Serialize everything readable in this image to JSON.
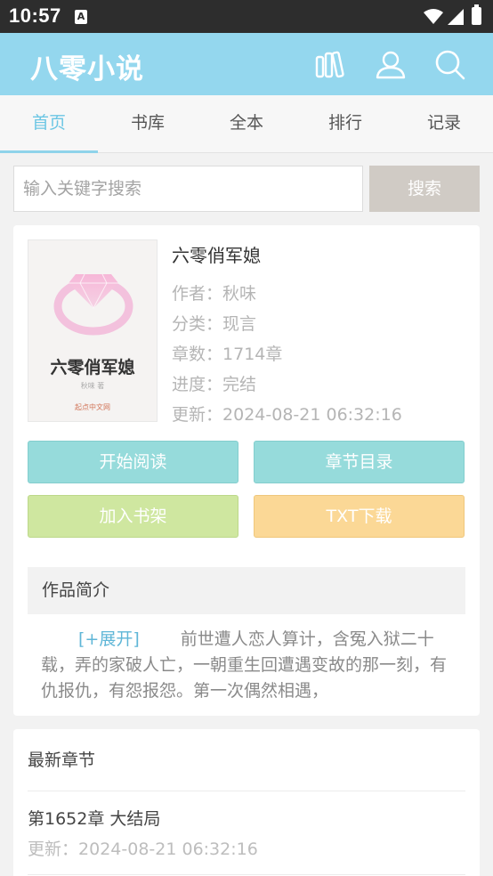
{
  "status_bar": {
    "time": "10:57",
    "notification_badge": "A"
  },
  "app": {
    "logo": "八零小说"
  },
  "tabs": [
    {
      "label": "首页",
      "active": true
    },
    {
      "label": "书库",
      "active": false
    },
    {
      "label": "全本",
      "active": false
    },
    {
      "label": "排行",
      "active": false
    },
    {
      "label": "记录",
      "active": false
    }
  ],
  "search": {
    "placeholder": "输入关键字搜索",
    "button_label": "搜索"
  },
  "book": {
    "cover_title": "六零俏军媳",
    "cover_author": "秋味 著",
    "cover_publisher": "起点中文网",
    "title": "六零俏军媳",
    "author_label": "作者：",
    "author": "秋味",
    "category_label": "分类：",
    "category": "现言",
    "chapters_label": "章数：",
    "chapters": "1714章",
    "progress_label": "进度：",
    "progress": "完结",
    "updated_label": "更新：",
    "updated": "2024-08-21 06:32:16"
  },
  "actions": {
    "read": "开始阅读",
    "toc": "章节目录",
    "add_shelf": "加入书架",
    "txt_download": "TXT下载"
  },
  "intro": {
    "heading": "作品简介",
    "expand": "[+展开]",
    "text": "前世遭人恋人算计，含冤入狱二十载，弄的家破人亡，一朝重生回遭遇变故的那一刻，有仇报仇，有怨报怨。第一次偶然相遇，"
  },
  "latest": {
    "heading": "最新章节",
    "chapter_title": "第1652章 大结局",
    "updated_label": "更新：",
    "updated": "2024-08-21 06:32:16"
  },
  "colors": {
    "app_bar": "#94d7ee",
    "tab_active": "#6cc6e4",
    "btn_teal": "#96dbdb",
    "btn_green": "#cfe7a0",
    "btn_orange": "#fbd896",
    "search_btn": "#d0cbc5"
  },
  "icons": [
    "bookshelf-icon",
    "user-icon",
    "search-icon",
    "wifi-icon",
    "signal-icon",
    "battery-icon",
    "diamond-ring-icon"
  ]
}
